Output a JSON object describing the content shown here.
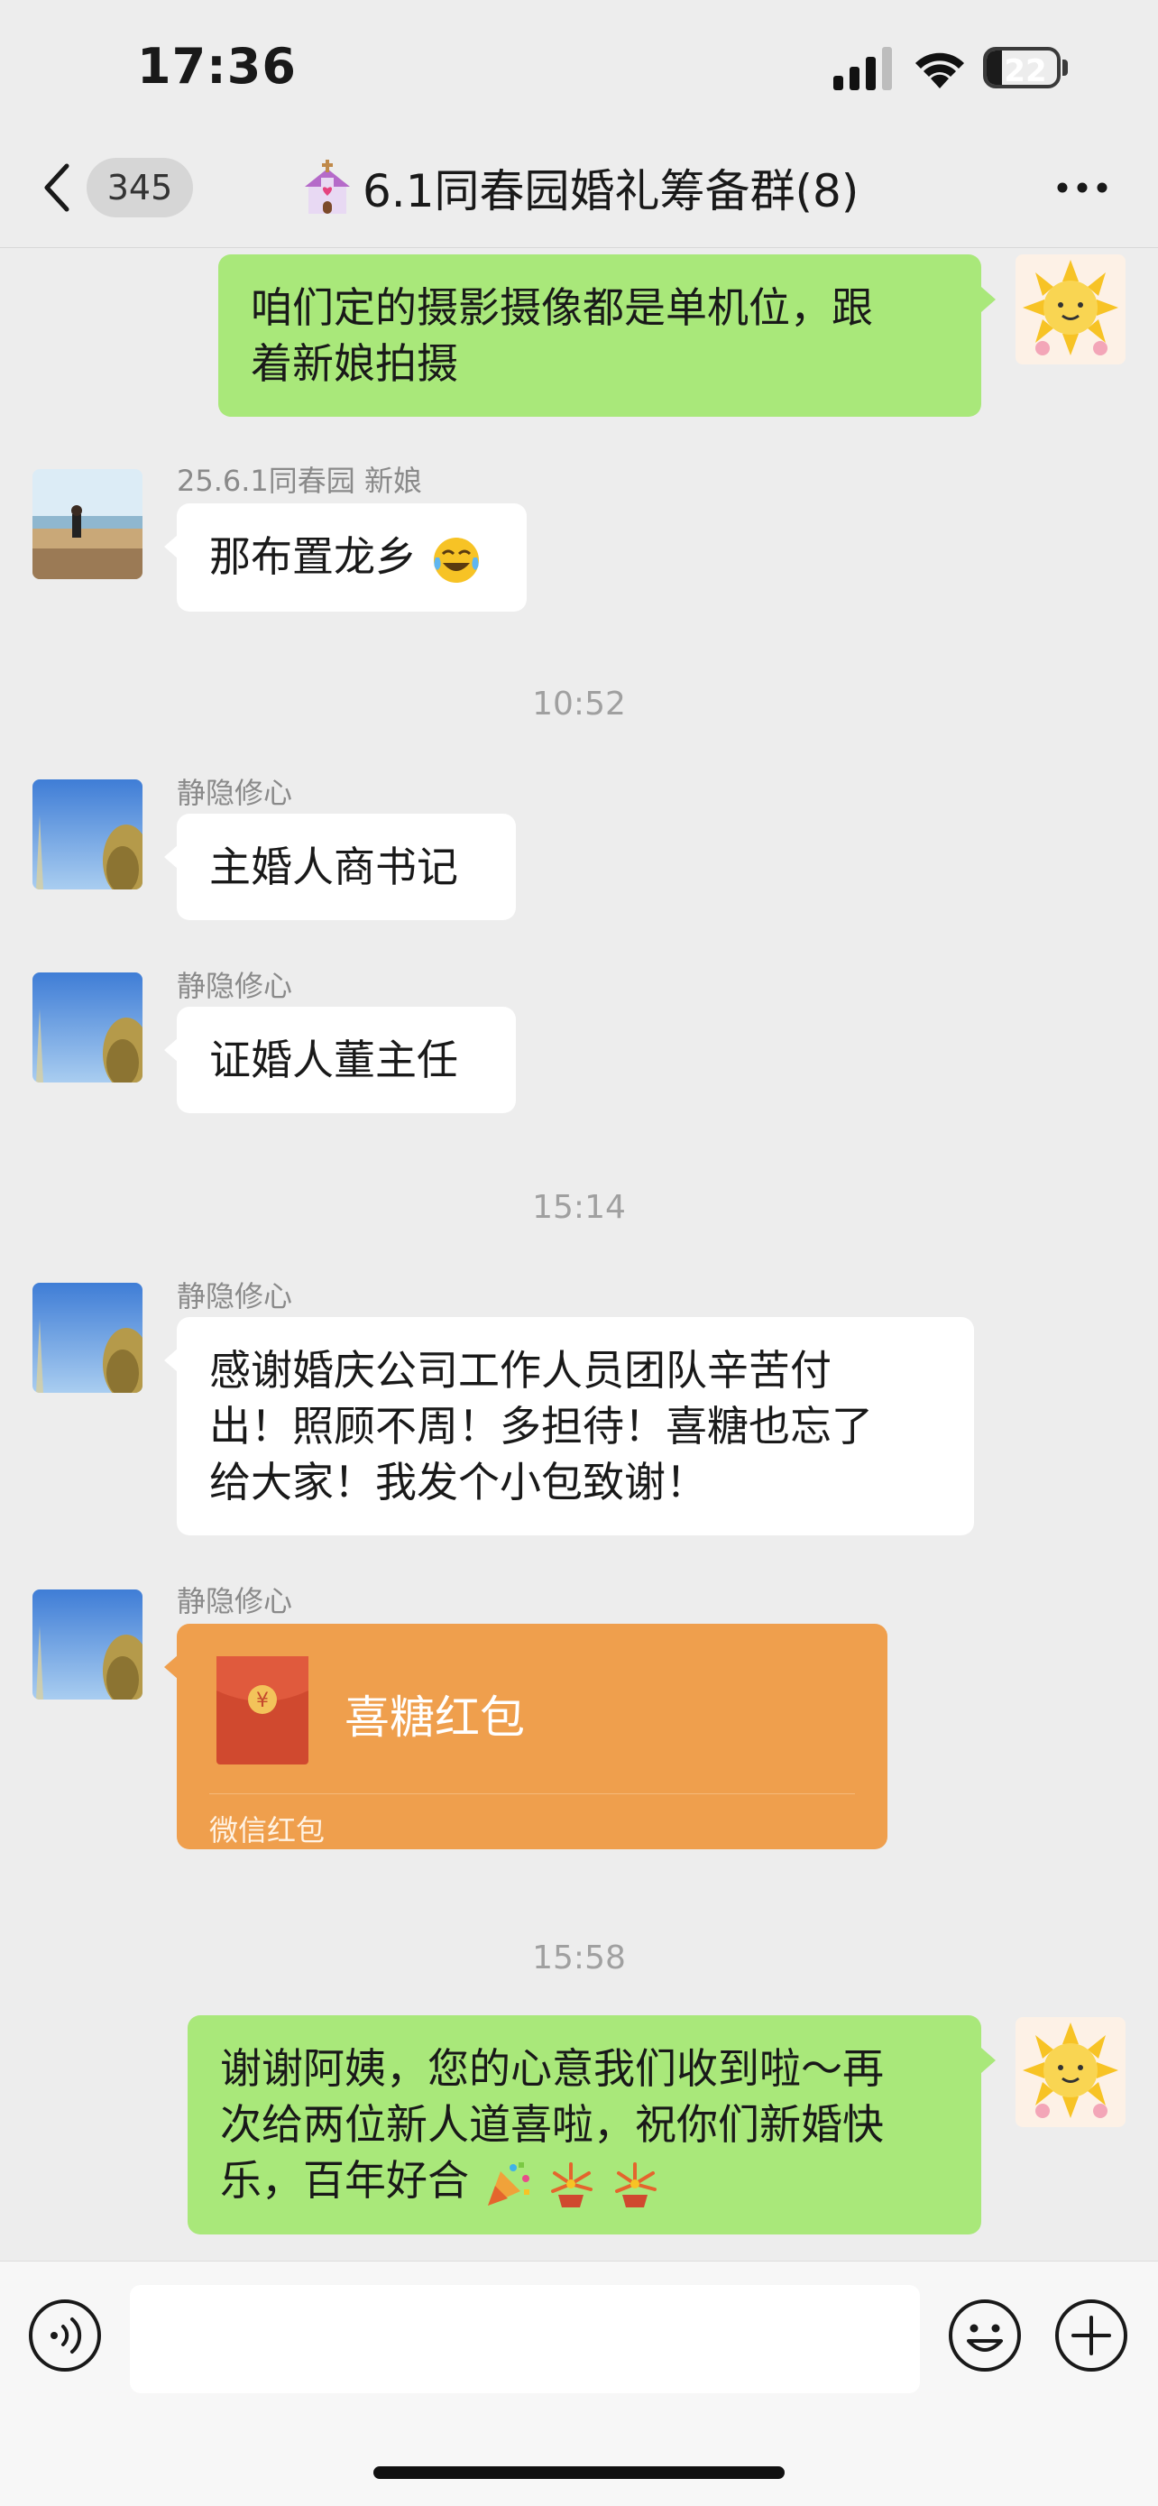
{
  "status_bar": {
    "time": "17:36",
    "battery_level": "22",
    "battery_fraction": 0.22
  },
  "nav": {
    "unread_count": "345",
    "title": "6.1同春园婚礼筹备群(8)",
    "title_icon": "church-emoji-icon",
    "more_icon": "ellipsis-icon"
  },
  "messages": [
    {
      "direction": "out",
      "text_lines": [
        "咱们定的摄影摄像都是单机位，跟",
        "着新娘拍摄"
      ]
    },
    {
      "direction": "in",
      "sender": "25.6.1同春园 新娘",
      "text": "那布置龙乡"
    },
    {
      "type": "time",
      "text": "10:52"
    },
    {
      "direction": "in",
      "sender": "静隐修心",
      "text": "主婚人商书记"
    },
    {
      "direction": "in",
      "sender": "静隐修心",
      "text": "证婚人董主任"
    },
    {
      "type": "time",
      "text": "15:14"
    },
    {
      "direction": "in",
      "sender": "静隐修心",
      "text_lines": [
        "感谢婚庆公司工作人员团队辛苦付",
        "出！照顾不周！多担待！喜糖也忘了",
        "给大家！我发个小包致谢！"
      ]
    },
    {
      "direction": "in",
      "sender": "静隐修心",
      "type": "red_packet",
      "title": "喜糖红包",
      "label": "微信红包",
      "symbol": "¥"
    },
    {
      "type": "time",
      "text": "15:58"
    },
    {
      "direction": "out",
      "text_lines": [
        "谢谢阿姨，您的心意我们收到啦～再",
        "次给两位新人道喜啦，祝你们新婚快",
        "乐，百年好合"
      ]
    }
  ],
  "input": {
    "placeholder": "",
    "voice_icon": "voice-icon",
    "emoji_icon": "emoji-icon",
    "plus_icon": "plus-icon"
  },
  "colors": {
    "background": "#ededed",
    "outgoing_bubble": "#a9e87a",
    "incoming_bubble": "#ffffff",
    "red_packet": "#ef9f4d"
  }
}
